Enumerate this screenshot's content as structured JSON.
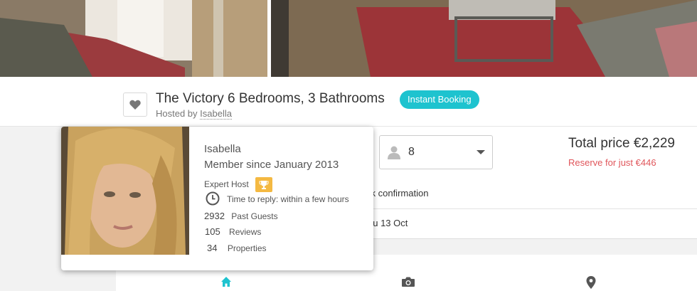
{
  "listing": {
    "title": "The Victory 6 Bedrooms, 3 Bathrooms",
    "badge": "Instant Booking",
    "hosted_by_prefix": "Hosted by",
    "host_name": "Isabella"
  },
  "host_card": {
    "name": "Isabella",
    "member_since": "Member since January 2013",
    "expert_label": "Expert Host",
    "reply_time": "Time to reply: within a few hours",
    "past_guests_count": "2932",
    "past_guests_label": "Past Guests",
    "reviews_count": "105",
    "reviews_label": "Reviews",
    "properties_count": "34",
    "properties_label": "Properties"
  },
  "booking": {
    "guests": "8",
    "total_price": "Total price €2,229",
    "reserve": "Reserve for just €446",
    "confirmation_fragment": "ck confirmation",
    "date_fragment": "hu 13 Oct"
  },
  "icons": {
    "favorite": "heart-icon",
    "guests": "person-icon",
    "reply": "clock-icon",
    "expert": "trophy-icon",
    "nav_home": "home-icon",
    "nav_photos": "camera-icon",
    "nav_location": "map-pin-icon"
  },
  "colors": {
    "accent": "#1ec3cf",
    "reserve": "#e0565b",
    "trophy": "#f4b942"
  }
}
